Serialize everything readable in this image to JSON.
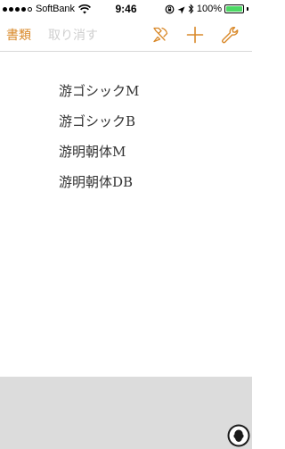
{
  "status_bar": {
    "carrier": "SoftBank",
    "time": "9:46",
    "battery_percent": "100%",
    "battery_level": 1.0,
    "battery_color": "#4cd964",
    "signal_bars_filled": 4,
    "signal_bars_total": 5
  },
  "toolbar": {
    "docs_label": "書類",
    "undo_label": "取り消す",
    "accent_color": "#d9892a",
    "icons": [
      "hammer-brush-icon",
      "plus-icon",
      "wrench-icon"
    ]
  },
  "documents": [
    {
      "label": "游ゴシックM"
    },
    {
      "label": "游ゴシックB"
    },
    {
      "label": "游明朝体M"
    },
    {
      "label": "游明朝体DB"
    }
  ]
}
